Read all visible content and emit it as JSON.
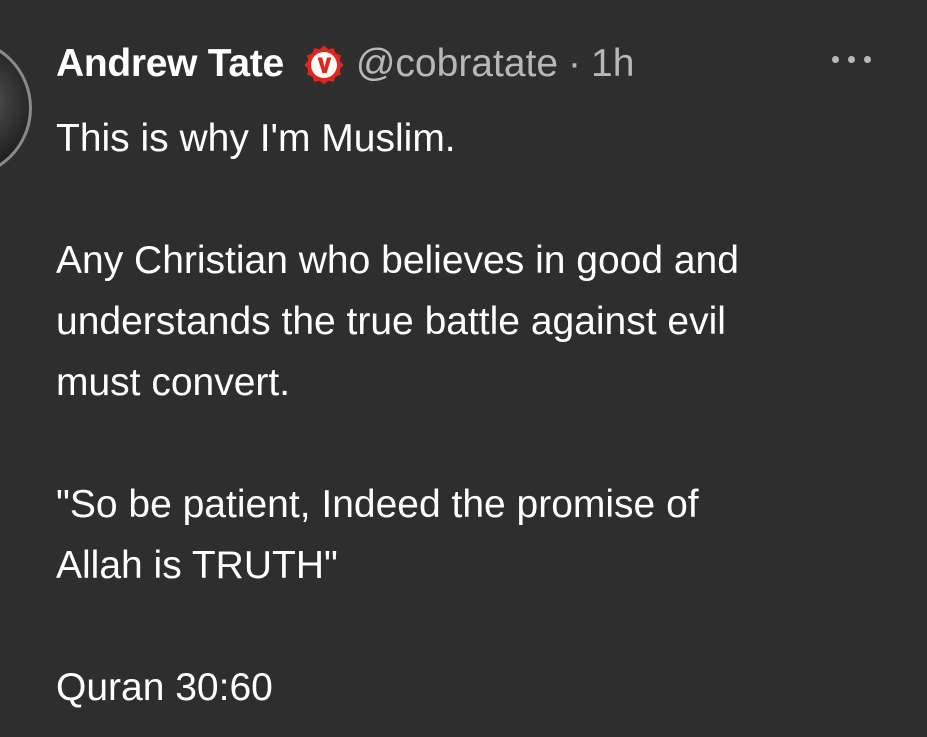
{
  "tweet": {
    "author_name": "Andrew Tate",
    "verified_badge_icon": "verified-v-badge-icon",
    "handle": "@cobratate",
    "separator": "·",
    "time": "1h",
    "more_icon": "more-horizontal-icon",
    "paragraphs": [
      [
        "This is why I'm Muslim."
      ],
      [
        "Any Christian who believes in good and",
        "understands the true battle against evil",
        "must convert."
      ],
      [
        "\"So be patient, Indeed the promise of",
        "Allah is TRUTH\""
      ],
      [
        "Quran 30:60"
      ]
    ]
  },
  "colors": {
    "background": "#2e2e2e",
    "text": "#ffffff",
    "muted": "#b8b8b8",
    "badge": "#e3261d"
  }
}
